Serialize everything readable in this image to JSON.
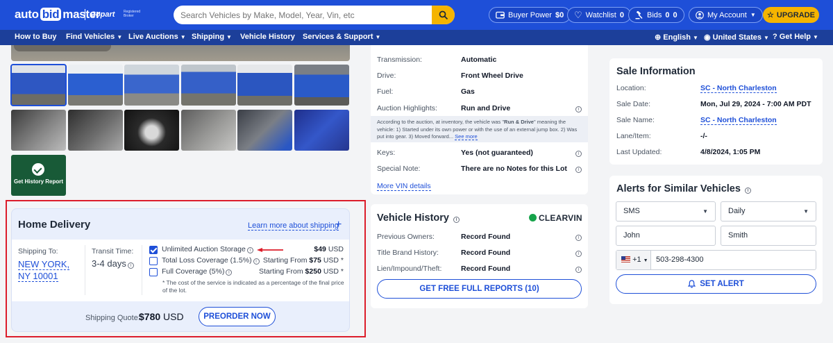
{
  "header": {
    "logo_text": [
      "auto",
      "bid",
      "master"
    ],
    "partner": "Copart",
    "partner_note": "Registered Broker",
    "search_placeholder": "Search Vehicles by Make, Model, Year, Vin, etc",
    "buyer_power_label": "Buyer Power",
    "buyer_power_value": "$0",
    "watchlist_label": "Watchlist",
    "watchlist_count": "0",
    "bids_label": "Bids",
    "bids_count_a": "0",
    "bids_count_b": "0",
    "account_label": "My Account",
    "upgrade_label": "UPGRADE"
  },
  "nav": {
    "items": [
      "How to Buy",
      "Find Vehicles",
      "Live Auctions",
      "Shipping",
      "Vehicle History",
      "Services & Support"
    ],
    "language": "English",
    "country": "United States",
    "help": "Get Help"
  },
  "gallery": {
    "history_tile_label": "Get History Report"
  },
  "home_delivery": {
    "title": "Home Delivery",
    "learn_more": "Learn more about shipping",
    "shipping_to_label": "Shipping To:",
    "shipping_to_line1": "NEW YORK,",
    "shipping_to_line2": "NY 10001",
    "transit_label": "Transit Time:",
    "transit_value": "3-4 days",
    "options": [
      {
        "label": "Unlimited Auction Storage",
        "price_prefix": "",
        "price_bold": "$49",
        "price_suffix": " USD",
        "checked": true
      },
      {
        "label": "Total Loss Coverage (1.5%)",
        "price_prefix": "Starting From ",
        "price_bold": "$75",
        "price_suffix": " USD *",
        "checked": false
      },
      {
        "label": "Full Coverage (5%)",
        "price_prefix": "Starting From ",
        "price_bold": "$250",
        "price_suffix": " USD *",
        "checked": false
      }
    ],
    "note": "* The cost of the service is indicated as a percentage of the final price of the lot.",
    "quote_label": "Shipping Quote:",
    "quote_value": "$780",
    "quote_currency": "USD",
    "preorder_label": "PREORDER NOW",
    "frame_color": "#dc1d2a"
  },
  "details": {
    "rows": [
      {
        "label": "Transmission:",
        "value": "Automatic"
      },
      {
        "label": "Drive:",
        "value": "Front Wheel Drive"
      },
      {
        "label": "Fuel:",
        "value": "Gas"
      },
      {
        "label": "Auction Highlights:",
        "value": "Run and Drive"
      }
    ],
    "highlight_text_a": "According to the auction, at inventory, the vehicle was \"",
    "highlight_bold": "Run & Drive",
    "highlight_text_b": "\" meaning the vehicle: 1) Started under its own power or with the use of an external jump box. 2) Was put into gear. 3) Moved forward...",
    "see_more": "See more",
    "rows2": [
      {
        "label": "Keys:",
        "value": "Yes (not guaranteed)"
      },
      {
        "label": "Special Note:",
        "value": "There are no Notes for this Lot"
      }
    ],
    "more_vin": "More VIN details"
  },
  "vehicle_history": {
    "title": "Vehicle History",
    "provider": "CLEARVIN",
    "rows": [
      {
        "label": "Previous Owners:",
        "value": "Record Found"
      },
      {
        "label": "Title Brand History:",
        "value": "Record Found"
      },
      {
        "label": "Lien/Impound/Theft:",
        "value": "Record Found"
      }
    ],
    "button": "GET FREE FULL REPORTS (10)"
  },
  "sale_info": {
    "title": "Sale Information",
    "rows": [
      {
        "label": "Location:",
        "value": "SC - North Charleston"
      },
      {
        "label": "Sale Date:",
        "value": "Mon, Jul 29, 2024 - 7:00 AM PDT"
      },
      {
        "label": "Sale Name:",
        "value": "SC - North Charleston"
      },
      {
        "label": "Lane/Item:",
        "value": "-/-"
      },
      {
        "label": "Last Updated:",
        "value": "4/8/2024, 1:05 PM"
      }
    ]
  },
  "alerts": {
    "title": "Alerts for Similar Vehicles",
    "method": "SMS",
    "frequency": "Daily",
    "first_name": "John",
    "last_name": "Smith",
    "phone_code": "+1",
    "phone": "503-298-4300",
    "button": "SET ALERT"
  },
  "colors": {
    "brand_blue": "#1e4fd8",
    "nav_blue": "#1c3f9a",
    "accent_yellow": "#f5b400"
  }
}
